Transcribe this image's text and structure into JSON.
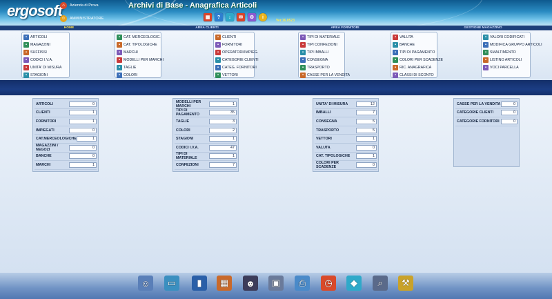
{
  "header": {
    "logo": "ergosoft",
    "company": "Azienda di Prova",
    "user": "AMMINISTRATORE",
    "title": "Archivi di Base - Anagrafica Articoli",
    "version": "Ver.16.0523",
    "toolbar_icons": [
      "calendar-icon",
      "help-icon",
      "download-icon",
      "mail-icon",
      "gear-icon",
      "info-icon"
    ]
  },
  "nav": {
    "tabs": [
      {
        "label": "HOME",
        "active": true
      },
      {
        "label": "AREA CLIENTI",
        "active": false
      },
      {
        "label": "AREA FORNITORI",
        "active": false
      },
      {
        "label": "GESTIONE MAGAZZINO",
        "active": false
      }
    ]
  },
  "menu": {
    "groups": [
      [
        "ARTICOLI",
        "MAGAZZINI",
        "SUFFISSI",
        "CODICI I.V.A.",
        "UNITA' DI MISURA",
        "STAGIONI"
      ],
      [
        "CAT. MERCEOLOGIC.",
        "CAT. TIPOLOGICHE",
        "MARCHI",
        "MODELLI PER MARCHI",
        "TAGLIE",
        "COLORI"
      ],
      [
        "CLIENTI",
        "FORNITORI",
        "OPERATORI/IMPIEG.",
        "CATEGORIE CLIENTI",
        "CATEG. FORNITORI",
        "VETTORI"
      ],
      [
        "TIPI DI MATERIALE",
        "TIPI CONFEZIONI",
        "TIPI IMBALLI",
        "CONSEGNA",
        "TRASPORTO",
        "CASSE PER LA VENDITA"
      ],
      [
        "VALUTA",
        "BANCHE",
        "TIPI DI PAGAMENTO",
        "COLORI PER SCADENZE",
        "RIC. ANAGRAFICA",
        "CLASSI DI SCONTO"
      ],
      [
        "VALORI CODIFICATI",
        "MODIFICA GRUPPO ARTICOLI",
        "SMALTIMENTO",
        "LISTINO ARTICOLI",
        "VOCI PARCELLA"
      ]
    ]
  },
  "panels": [
    [
      [
        "ARTICOLI",
        "0"
      ],
      [
        "CLIENTI",
        "1"
      ],
      [
        "FORNITORI",
        "1"
      ],
      [
        "IMPIEGATI",
        "0"
      ],
      [
        "CAT.MERCEOLOGICHE",
        "1"
      ],
      [
        "MAGAZZINI / NEGOZI",
        "0"
      ],
      [
        "BANCHE",
        "0"
      ],
      [
        "MARCHI",
        "1"
      ]
    ],
    [
      [
        "MODELLI PER MARCHI",
        "1"
      ],
      [
        "TIPI DI PAGAMENTO",
        "35"
      ],
      [
        "TAGLIE",
        "3"
      ],
      [
        "COLORI",
        "2"
      ],
      [
        "STAGIONI",
        "1"
      ],
      [
        "CODICI I.V.A.",
        "47"
      ],
      [
        "TIPI DI MATERIALE",
        "1"
      ],
      [
        "CONFEZIONI",
        "7"
      ]
    ],
    [
      [
        "UNITA' DI MISURA",
        "12"
      ],
      [
        "IMBALLI",
        "7"
      ],
      [
        "CONSEGNA",
        "5"
      ],
      [
        "TRASPORTO",
        "5"
      ],
      [
        "VETTORI",
        "1"
      ],
      [
        "VALUTA",
        "0"
      ],
      [
        "CAT. TIPOLOGICHE",
        "1"
      ],
      [
        "COLORI PER SCADENZE",
        "0"
      ]
    ],
    [
      [
        "CASSE PER LA VENDITA",
        "0"
      ],
      [
        "CATEGORIE CLIENTI",
        "0"
      ],
      [
        "CATEGORIE FORNITORI",
        "0"
      ]
    ]
  ],
  "footer_icons": [
    "user-icon",
    "card-icon",
    "book-icon",
    "folders-icon",
    "operator-icon",
    "save-icon",
    "printer-icon",
    "calendar-clock-icon",
    "tag-icon",
    "search-icon",
    "tools-icon"
  ]
}
